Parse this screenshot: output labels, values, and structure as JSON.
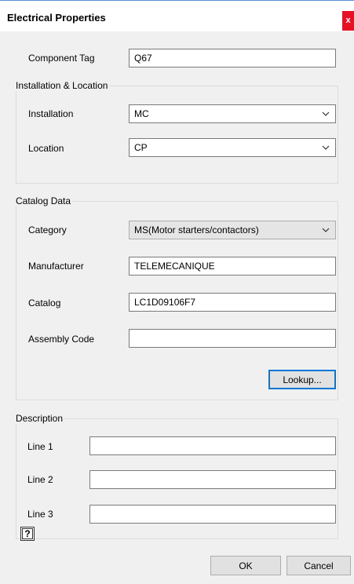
{
  "window": {
    "title": "Electrical Properties",
    "close_glyph": "x"
  },
  "component_tag": {
    "label": "Component Tag",
    "value": "Q67"
  },
  "installation_location": {
    "group_label": "Installation & Location",
    "installation": {
      "label": "Installation",
      "value": "MC"
    },
    "location": {
      "label": "Location",
      "value": "CP"
    }
  },
  "catalog_data": {
    "group_label": "Catalog Data",
    "category": {
      "label": "Category",
      "value": "MS(Motor starters/contactors)"
    },
    "manufacturer": {
      "label": "Manufacturer",
      "value": "TELEMECANIQUE"
    },
    "catalog": {
      "label": "Catalog",
      "value": "LC1D09106F7"
    },
    "assembly_code": {
      "label": "Assembly Code",
      "value": ""
    },
    "lookup_label": "Lookup..."
  },
  "description": {
    "group_label": "Description",
    "line1": {
      "label": "Line 1",
      "value": ""
    },
    "line2": {
      "label": "Line 2",
      "value": ""
    },
    "line3": {
      "label": "Line 3",
      "value": ""
    }
  },
  "footer": {
    "help_glyph": "?",
    "ok_label": "OK",
    "cancel_label": "Cancel"
  }
}
